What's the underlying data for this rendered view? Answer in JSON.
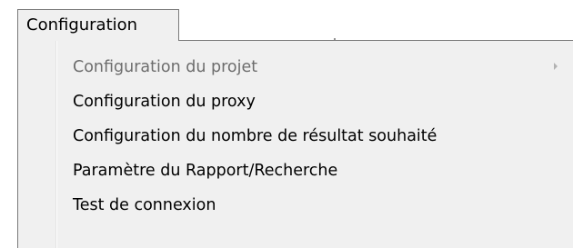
{
  "menubar": {
    "title": "Configuration"
  },
  "dropdown": {
    "items": [
      {
        "label": "Configuration du projet",
        "enabled": false,
        "has_submenu": true,
        "submenu_icon": "chevron-right-icon"
      },
      {
        "label": "Configuration du proxy",
        "enabled": true,
        "has_submenu": false
      },
      {
        "label": "Configuration du nombre de résultat souhaité",
        "enabled": true,
        "has_submenu": false
      },
      {
        "label": "Paramètre du Rapport/Recherche",
        "enabled": true,
        "has_submenu": false
      },
      {
        "label": "Test de connexion",
        "enabled": true,
        "has_submenu": false
      }
    ]
  },
  "colors": {
    "menu_background": "#f0f0f0",
    "border": "#7a7a7a",
    "text": "#000000",
    "disabled_text": "#6d6d6d"
  }
}
